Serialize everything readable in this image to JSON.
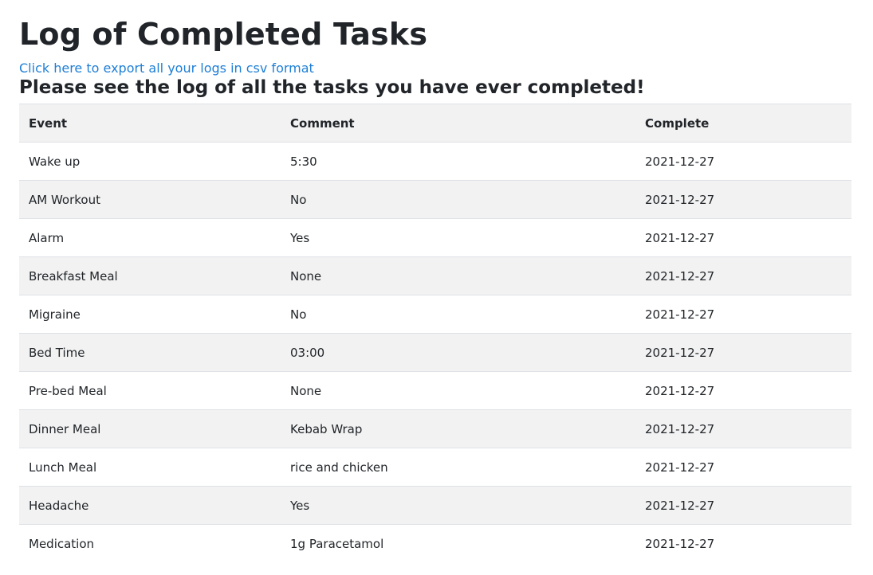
{
  "page": {
    "title": "Log of Completed Tasks",
    "export_link": "Click here to export all your logs in csv format",
    "subtitle": "Please see the log of all the tasks you have ever completed!"
  },
  "table": {
    "headers": {
      "event": "Event",
      "comment": "Comment",
      "complete": "Complete"
    },
    "rows": [
      {
        "event": "Wake up",
        "comment": "5:30",
        "complete": "2021-12-27"
      },
      {
        "event": "AM Workout",
        "comment": "No",
        "complete": "2021-12-27"
      },
      {
        "event": "Alarm",
        "comment": "Yes",
        "complete": "2021-12-27"
      },
      {
        "event": "Breakfast Meal",
        "comment": "None",
        "complete": "2021-12-27"
      },
      {
        "event": "Migraine",
        "comment": "No",
        "complete": "2021-12-27"
      },
      {
        "event": "Bed Time",
        "comment": "03:00",
        "complete": "2021-12-27"
      },
      {
        "event": "Pre-bed Meal",
        "comment": "None",
        "complete": "2021-12-27"
      },
      {
        "event": "Dinner Meal",
        "comment": "Kebab Wrap",
        "complete": "2021-12-27"
      },
      {
        "event": "Lunch Meal",
        "comment": "rice and chicken",
        "complete": "2021-12-27"
      },
      {
        "event": "Headache",
        "comment": "Yes",
        "complete": "2021-12-27"
      },
      {
        "event": "Medication",
        "comment": "1g Paracetamol",
        "complete": "2021-12-27"
      }
    ]
  },
  "colors": {
    "link": "#1e7fd6",
    "stripe": "#f2f2f2",
    "text": "#212529",
    "border": "#dee2e6"
  }
}
